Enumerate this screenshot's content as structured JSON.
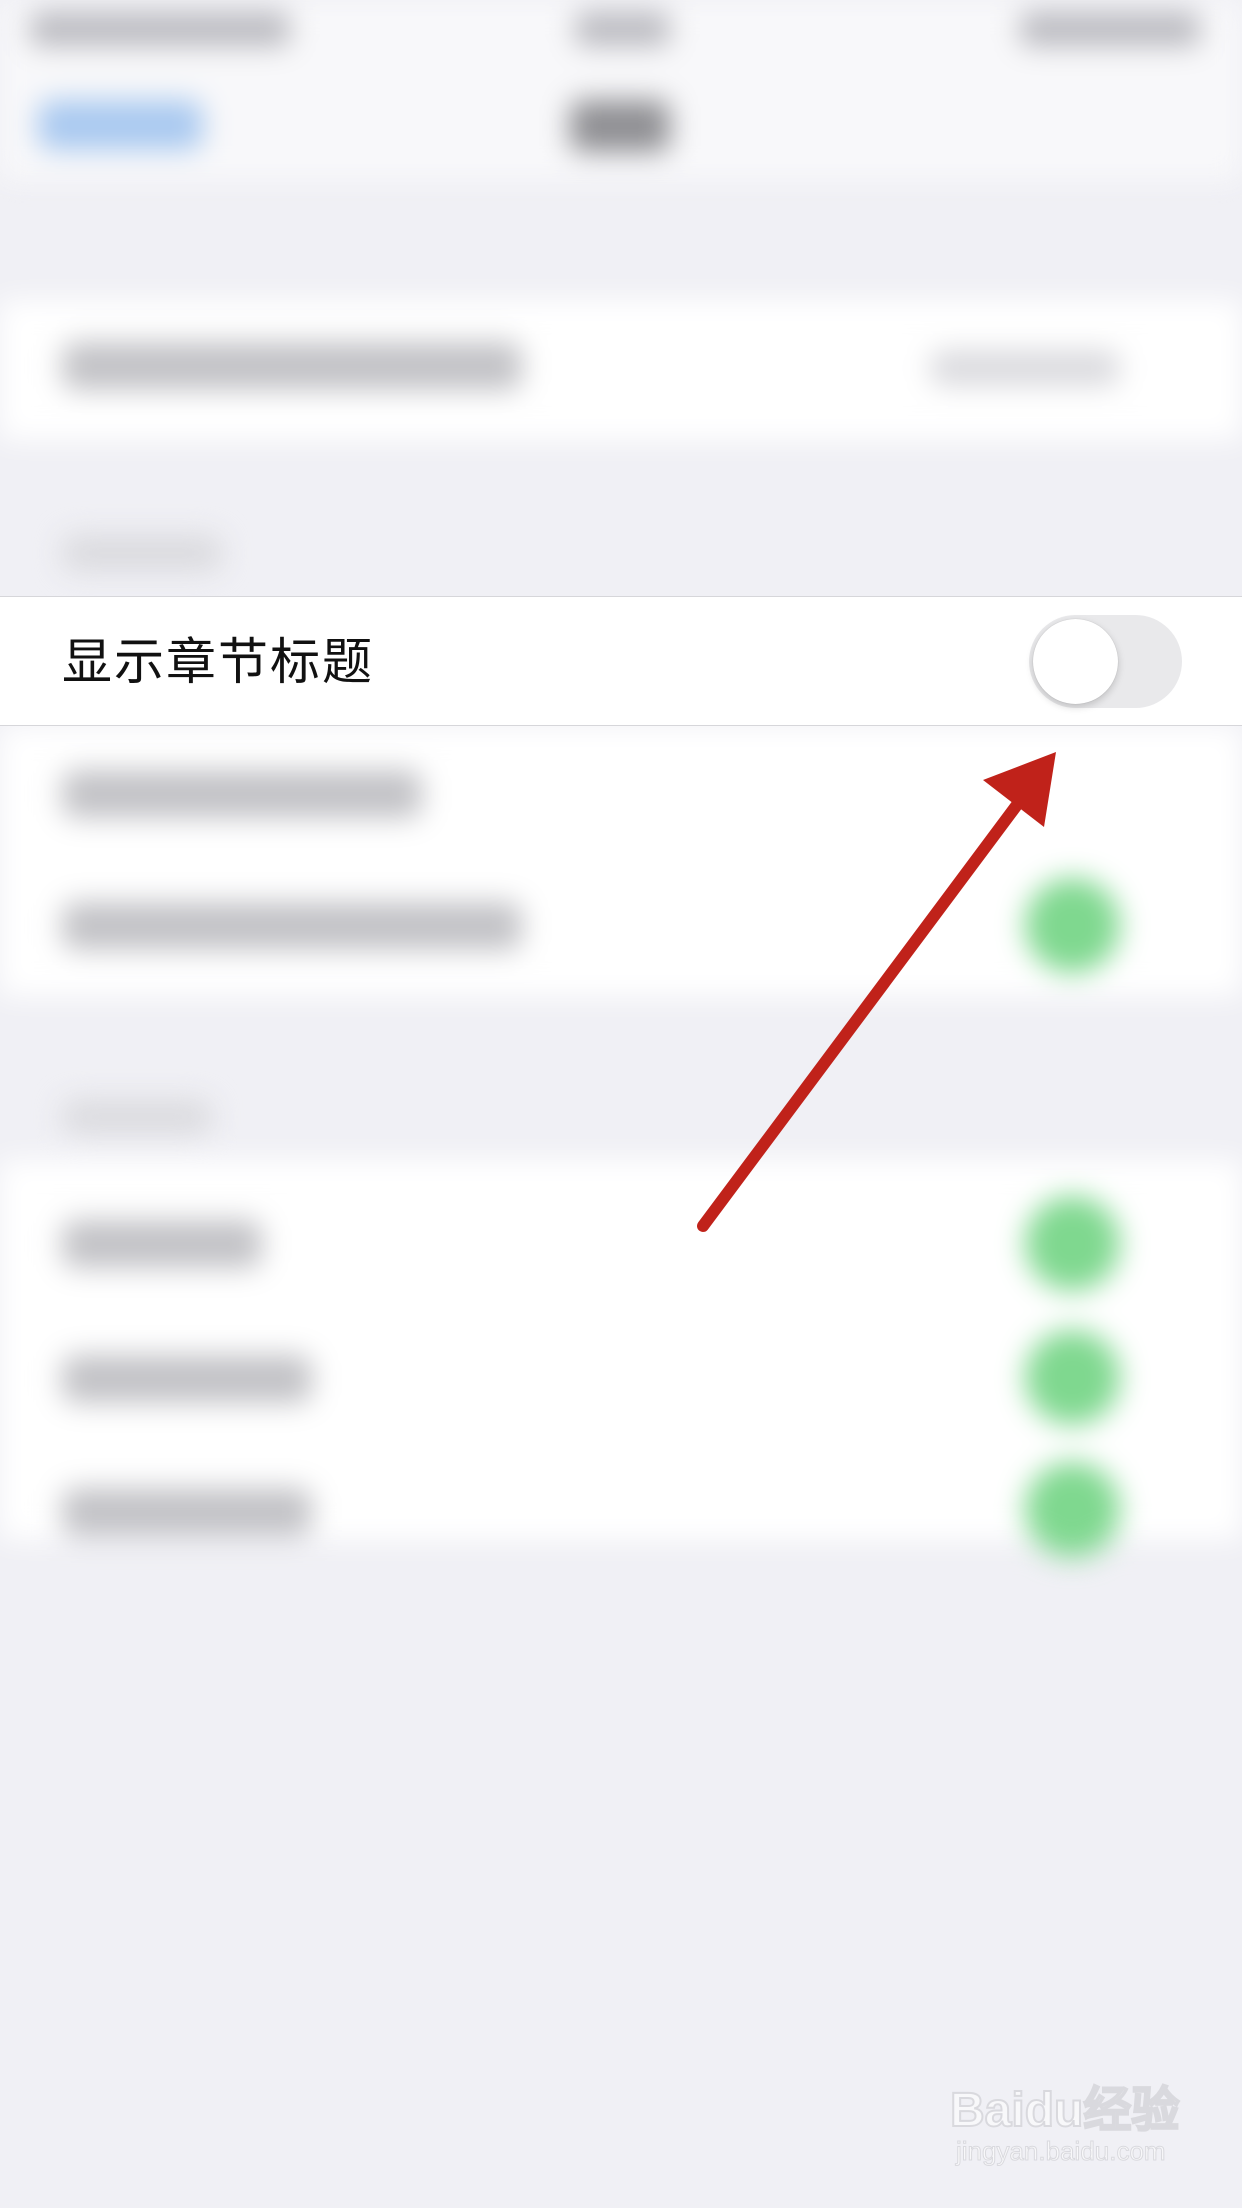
{
  "setting": {
    "label": "显示章节标题",
    "toggle_state": "off"
  },
  "watermark": {
    "logo": "Baidu经验",
    "url": "jingyan.baidu.com"
  },
  "colors": {
    "toggle_off_track": "#e9e9eb",
    "toggle_knob": "#ffffff",
    "arrow": "#c0221a",
    "background": "#f0f0f5"
  }
}
